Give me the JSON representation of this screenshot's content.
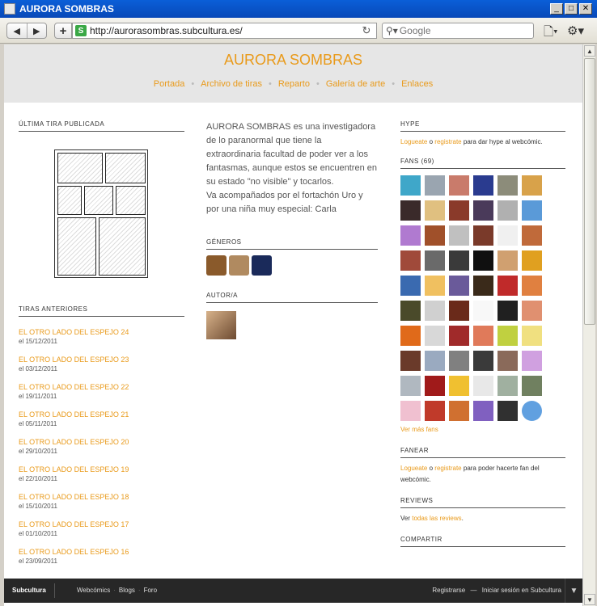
{
  "window": {
    "title": "AURORA SOMBRAS",
    "minimize": "_",
    "maximize": "□",
    "close": "✕"
  },
  "toolbar": {
    "url": "http://aurorasombras.subcultura.es/",
    "search_placeholder": "Google",
    "site_icon": "S",
    "back": "◀",
    "forward": "▶",
    "add": "+",
    "reload": "↻",
    "search_glyph": "⚲▾",
    "page_menu": "🗋▾",
    "tools_menu": "⚙▾"
  },
  "site": {
    "title": "AURORA SOMBRAS",
    "nav": [
      "Portada",
      "Archivo de tiras",
      "Reparto",
      "Galería de arte",
      "Enlaces"
    ]
  },
  "left": {
    "latest_title": "ÚLTIMA TIRA PUBLICADA",
    "previous_title": "TIRAS ANTERIORES",
    "archive": [
      {
        "title": "EL OTRO LADO DEL ESPEJO 24",
        "date": "el 15/12/2011"
      },
      {
        "title": "EL OTRO LADO DEL ESPEJO 23",
        "date": "el 03/12/2011"
      },
      {
        "title": "EL OTRO LADO DEL ESPEJO 22",
        "date": "el 19/11/2011"
      },
      {
        "title": "EL OTRO LADO DEL ESPEJO 21",
        "date": "el 05/11/2011"
      },
      {
        "title": "EL OTRO LADO DEL ESPEJO 20",
        "date": "el 29/10/2011"
      },
      {
        "title": "EL OTRO LADO DEL ESPEJO 19",
        "date": "el 22/10/2011"
      },
      {
        "title": "EL OTRO LADO DEL ESPEJO 18",
        "date": "el 15/10/2011"
      },
      {
        "title": "EL OTRO LADO DEL ESPEJO 17",
        "date": "el 01/10/2011"
      },
      {
        "title": "EL OTRO LADO DEL ESPEJO 16",
        "date": "el 23/09/2011"
      }
    ]
  },
  "middle": {
    "description": "AURORA SOMBRAS es una investigadora de lo paranormal que tiene la extraordinaria facultad de poder ver a los fantasmas, aunque estos se encuentren en su estado \"no visible\" y tocarlos.",
    "description2": "Va acompañados por el fortachón Uro y por una niña muy especial: Carla",
    "genres_title": "GÉNEROS",
    "genre_colors": [
      "#8a5a2b",
      "#b08a60",
      "#1a2a5a"
    ],
    "author_title": "AUTOR/A"
  },
  "right": {
    "hype_title": "HYPE",
    "hype_login": "Logueate",
    "hype_or": " o ",
    "hype_register": "registrate",
    "hype_text": " para dar hype al webcómic.",
    "fans_title": "FANS (69)",
    "fan_colors": [
      "#3fa7c9",
      "#9aa5b0",
      "#c97b6b",
      "#2a3b8f",
      "#8c8c7a",
      "#d8a24a",
      "#3a2a2a",
      "#e0c080",
      "#8a3a2a",
      "#4a3a5a",
      "#b0b0b0",
      "#5a9ad8",
      "#b07ad0",
      "#a0502a",
      "#c0c0c0",
      "#7a3a2a",
      "#f0f0f0",
      "#c06a3a",
      "#a04a3a",
      "#6a6a6a",
      "#3a3a3a",
      "#101010",
      "#d0a070",
      "#e0a020",
      "#3a6ab0",
      "#f0c060",
      "#6a5a9a",
      "#3a2a1a",
      "#c02a2a",
      "#e08040",
      "#4a4a2a",
      "#d0d0d0",
      "#6a2a1a",
      "#f8f8f8",
      "#202020",
      "#e09070",
      "#e06a1a",
      "#d8d8d8",
      "#a02a2a",
      "#e07a5a",
      "#c0d040",
      "#f0e080",
      "#6a3a2a",
      "#9aaac0",
      "#808080",
      "#3a3a3a",
      "#8a6a5a",
      "#d0a0e0",
      "#b0b8c0",
      "#a01a1a",
      "#f0c030",
      "#e8e8e8",
      "#a0b0a0",
      "#708060",
      "#f0c0d0",
      "#c03a2a",
      "#d07030",
      "#8060c0",
      "#303030",
      "#60a0e0"
    ],
    "more_fans": "Ver más fans",
    "fan_title": "FANEAR",
    "fan_login": "Logueate",
    "fan_or": " o ",
    "fan_register": "registrate",
    "fan_text": " para poder hacerte fan del webcómic.",
    "reviews_title": "REVIEWS",
    "reviews_prefix": "Ver ",
    "reviews_link": "todas las reviews",
    "reviews_suffix": ".",
    "share_title": "COMPARTIR"
  },
  "bottombar": {
    "brand": "Subcultura",
    "links": [
      "Webcómics",
      "Blogs",
      "Foro"
    ],
    "register": "Registrarse",
    "separator": "—",
    "login": "Iniciar sesión en Subcultura",
    "toggle": "▼"
  },
  "scrollbar": {
    "up": "▲",
    "down": "▼"
  }
}
